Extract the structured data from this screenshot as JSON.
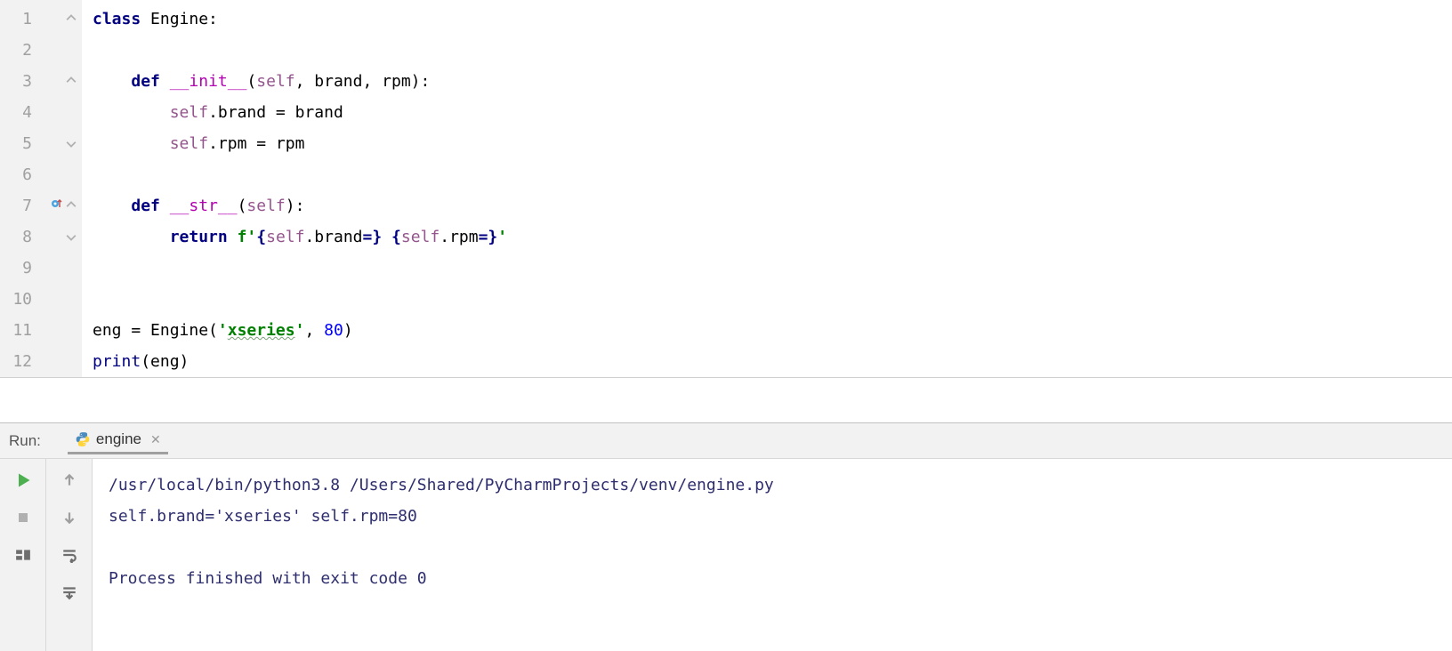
{
  "editor": {
    "lines": [
      {
        "num": "1",
        "fold": "open",
        "tokens": [
          [
            "kw",
            "class"
          ],
          [
            "plain",
            " Engine:"
          ]
        ]
      },
      {
        "num": "2",
        "tokens": []
      },
      {
        "num": "3",
        "fold": "open",
        "indent": 1,
        "tokens": [
          [
            "plain",
            "    "
          ],
          [
            "kw",
            "def"
          ],
          [
            "plain",
            " "
          ],
          [
            "fn-name",
            "__init__"
          ],
          [
            "plain",
            "("
          ],
          [
            "self",
            "self"
          ],
          [
            "plain",
            ", brand, rpm):"
          ]
        ]
      },
      {
        "num": "4",
        "indent": 2,
        "tokens": [
          [
            "plain",
            "        "
          ],
          [
            "self",
            "self"
          ],
          [
            "plain",
            ".brand = brand"
          ]
        ]
      },
      {
        "num": "5",
        "fold": "close",
        "indent": 2,
        "tokens": [
          [
            "plain",
            "        "
          ],
          [
            "self",
            "self"
          ],
          [
            "plain",
            ".rpm = rpm"
          ]
        ]
      },
      {
        "num": "6",
        "tokens": []
      },
      {
        "num": "7",
        "fold": "open",
        "override": true,
        "indent": 1,
        "tokens": [
          [
            "plain",
            "    "
          ],
          [
            "kw",
            "def"
          ],
          [
            "plain",
            " "
          ],
          [
            "fn-name",
            "__str__"
          ],
          [
            "plain",
            "("
          ],
          [
            "self",
            "self"
          ],
          [
            "plain",
            "):"
          ]
        ]
      },
      {
        "num": "8",
        "fold": "close",
        "indent": 2,
        "tokens": [
          [
            "plain",
            "        "
          ],
          [
            "kw",
            "return"
          ],
          [
            "plain",
            " "
          ],
          [
            "str",
            "f'"
          ],
          [
            "fstr-expr",
            "{"
          ],
          [
            "self",
            "self"
          ],
          [
            "plain",
            ".brand"
          ],
          [
            "fstr-expr",
            "=}"
          ],
          [
            "str",
            " "
          ],
          [
            "fstr-expr",
            "{"
          ],
          [
            "self",
            "self"
          ],
          [
            "plain",
            ".rpm"
          ],
          [
            "fstr-expr",
            "=}"
          ],
          [
            "str",
            "'"
          ]
        ]
      },
      {
        "num": "9",
        "tokens": []
      },
      {
        "num": "10",
        "tokens": []
      },
      {
        "num": "11",
        "tokens": [
          [
            "plain",
            "eng = Engine("
          ],
          [
            "str",
            "'"
          ],
          [
            "str-typo",
            "xseries"
          ],
          [
            "str",
            "'"
          ],
          [
            "plain",
            ", "
          ],
          [
            "num",
            "80"
          ],
          [
            "plain",
            ")"
          ]
        ]
      },
      {
        "num": "12",
        "tokens": [
          [
            "builtin",
            "print"
          ],
          [
            "plain",
            "(eng)"
          ]
        ]
      }
    ]
  },
  "run": {
    "label": "Run:",
    "tab": "engine",
    "console": [
      "/usr/local/bin/python3.8 /Users/Shared/PyCharmProjects/venv/engine.py",
      "self.brand='xseries' self.rpm=80",
      "",
      "Process finished with exit code 0"
    ]
  }
}
